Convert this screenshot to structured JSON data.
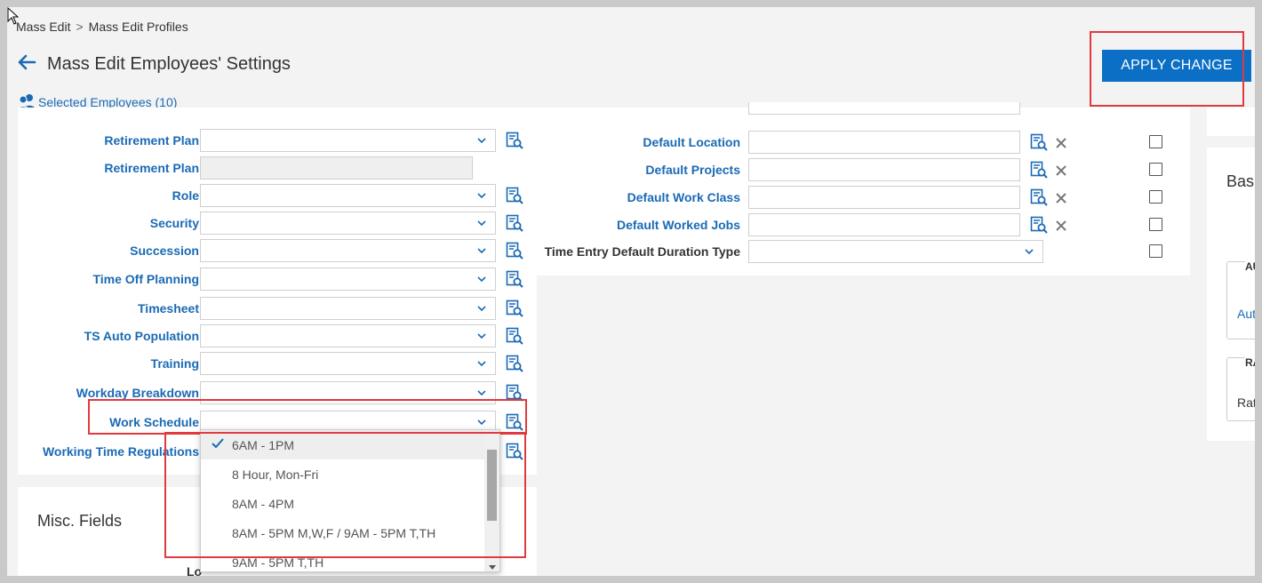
{
  "breadcrumb": {
    "items": [
      "Mass Edit",
      "Mass Edit Profiles"
    ],
    "separator": ">"
  },
  "page": {
    "title": "Mass Edit Employees' Settings",
    "selected_employees": "Selected Employees (10)"
  },
  "toolbar": {
    "apply_label": "APPLY CHANGE"
  },
  "left_fields": [
    {
      "label": "Retirement Plan",
      "type": "select"
    },
    {
      "label": "Retirement Plan",
      "type": "disabled"
    },
    {
      "label": "Role",
      "type": "select"
    },
    {
      "label": "Security",
      "type": "select"
    },
    {
      "label": "Succession",
      "type": "select"
    },
    {
      "label": "Time Off Planning",
      "type": "select"
    },
    {
      "label": "Timesheet",
      "type": "select"
    },
    {
      "label": "TS Auto Population",
      "type": "select"
    },
    {
      "label": "Training",
      "type": "select"
    },
    {
      "label": "Workday Breakdown",
      "type": "select"
    },
    {
      "label": "Work Schedule",
      "type": "select"
    },
    {
      "label": "Working Time Regulations",
      "type": "select"
    }
  ],
  "mid_fields": [
    {
      "label": "Default Location",
      "type": "lookup"
    },
    {
      "label": "Default Projects",
      "type": "lookup"
    },
    {
      "label": "Default Work Class",
      "type": "lookup"
    },
    {
      "label": "Default Worked Jobs",
      "type": "lookup"
    },
    {
      "label": "Time Entry Default Duration Type",
      "type": "select"
    }
  ],
  "work_schedule_dropdown": {
    "selected": "6AM - 1PM",
    "options": [
      "6AM - 1PM",
      "8 Hour, Mon-Fri",
      "8AM - 4PM",
      "8AM - 5PM M,W,F / 9AM - 5PM T,TH",
      "9AM - 5PM T,TH"
    ]
  },
  "misc": {
    "title": "Misc. Fields",
    "partial_label": "Lo"
  },
  "right_panel": {
    "heading": "Bas",
    "group1_legend": "AU",
    "group1_text": "Aut",
    "group2_legend": "RA",
    "group2_text": "Rat"
  },
  "colors": {
    "link_blue": "#1a6ab5",
    "apply_bg": "#0b6fc6",
    "highlight_red": "#e0393e"
  }
}
